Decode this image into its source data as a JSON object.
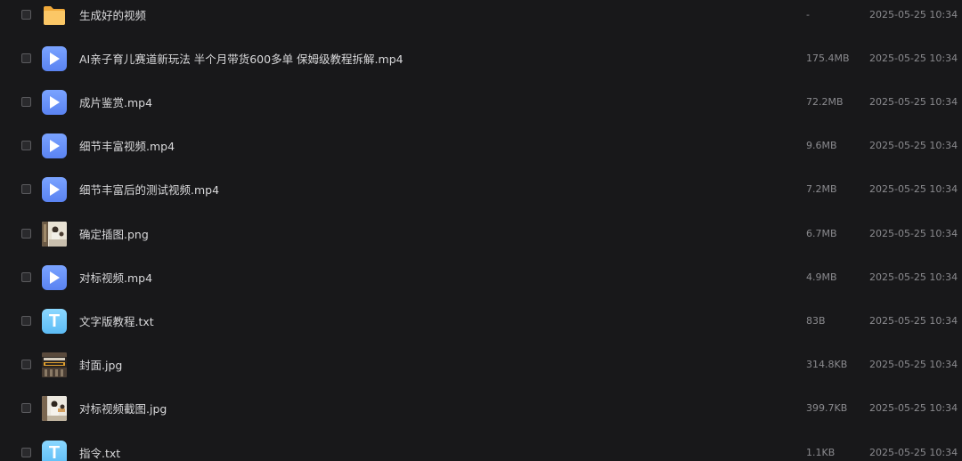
{
  "files": [
    {
      "name": "生成好的视频",
      "size": "-",
      "date": "2025-05-25 10:34",
      "icon": "folder-icon"
    },
    {
      "name": "AI亲子育儿赛道新玩法 半个月带货600多单 保姆级教程拆解.mp4",
      "size": "175.4MB",
      "date": "2025-05-25 10:34",
      "icon": "video-file-icon"
    },
    {
      "name": "成片鉴赏.mp4",
      "size": "72.2MB",
      "date": "2025-05-25 10:34",
      "icon": "video-file-icon"
    },
    {
      "name": "细节丰富视频.mp4",
      "size": "9.6MB",
      "date": "2025-05-25 10:34",
      "icon": "video-file-icon"
    },
    {
      "name": "细节丰富后的测试视频.mp4",
      "size": "7.2MB",
      "date": "2025-05-25 10:34",
      "icon": "video-file-icon"
    },
    {
      "name": "确定插图.png",
      "size": "6.7MB",
      "date": "2025-05-25 10:34",
      "icon": "image-thumbnail"
    },
    {
      "name": "对标视频.mp4",
      "size": "4.9MB",
      "date": "2025-05-25 10:34",
      "icon": "video-file-icon"
    },
    {
      "name": "文字版教程.txt",
      "size": "83B",
      "date": "2025-05-25 10:34",
      "icon": "text-file-icon"
    },
    {
      "name": "封面.jpg",
      "size": "314.8KB",
      "date": "2025-05-25 10:34",
      "icon": "image-thumbnail"
    },
    {
      "name": "对标视频截图.jpg",
      "size": "399.7KB",
      "date": "2025-05-25 10:34",
      "icon": "image-thumbnail"
    },
    {
      "name": "指令.txt",
      "size": "1.1KB",
      "date": "2025-05-25 10:34",
      "icon": "text-file-icon"
    }
  ],
  "colors": {
    "background": "#18181a",
    "folder": "#f7b84b",
    "video_icon": "#6b93fb",
    "text_icon": "#6cc7fb"
  }
}
